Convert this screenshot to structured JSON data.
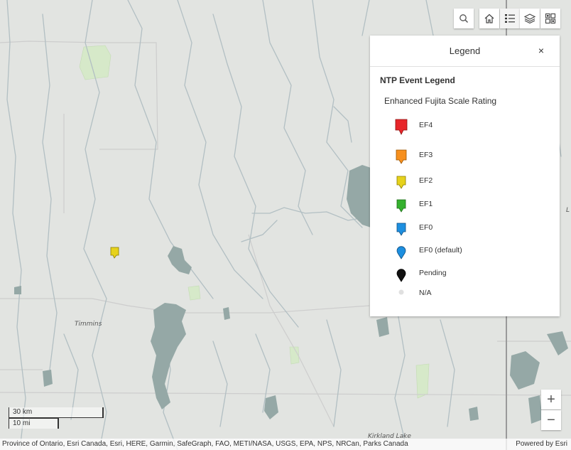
{
  "map": {
    "labels": [
      "Timmins",
      "Kirkland Lake",
      "L"
    ],
    "colors": {
      "land": "#e2e4e1",
      "water": "#95a8a6",
      "rivers": "#b3c0c4",
      "park": "#d6e9c9",
      "roads": "#cfcfcf",
      "border": "#9a9a9a"
    }
  },
  "toolbar": {
    "search_icon": "search-icon",
    "home_icon": "home-icon",
    "legend_icon": "list-icon",
    "layers_icon": "layers-icon",
    "basemap_icon": "grid-icon"
  },
  "legend": {
    "title": "Legend",
    "close": "×",
    "layer_title": "NTP Event Legend",
    "field_title": "Enhanced Fujita Scale Rating",
    "items": [
      {
        "label": "EF4",
        "color": "#e8262a",
        "symbol": "square-pin"
      },
      {
        "label": "EF3",
        "color": "#f7901e",
        "symbol": "square-pin"
      },
      {
        "label": "EF2",
        "color": "#e6d21c",
        "symbol": "square-pin"
      },
      {
        "label": "EF1",
        "color": "#35b12e",
        "symbol": "square-pin"
      },
      {
        "label": "EF0",
        "color": "#1d8fe0",
        "symbol": "square-pin"
      },
      {
        "label": "EF0 (default)",
        "color": "#1d8fe0",
        "symbol": "round-pin"
      },
      {
        "label": "Pending",
        "color": "#111111",
        "symbol": "round-pin"
      },
      {
        "label": "N/A",
        "color": "#e0e0e0",
        "symbol": "dot"
      }
    ]
  },
  "zoom": {
    "in": "+",
    "out": "−"
  },
  "scale": {
    "metric": "30 km",
    "imperial": "10 mi"
  },
  "attribution": {
    "text": "Province of Ontario, Esri Canada, Esri, HERE, Garmin, SafeGraph, FAO, METI/NASA, USGS, EPA, NPS, NRCan, Parks Canada",
    "powered_by": "Powered by Esri"
  }
}
